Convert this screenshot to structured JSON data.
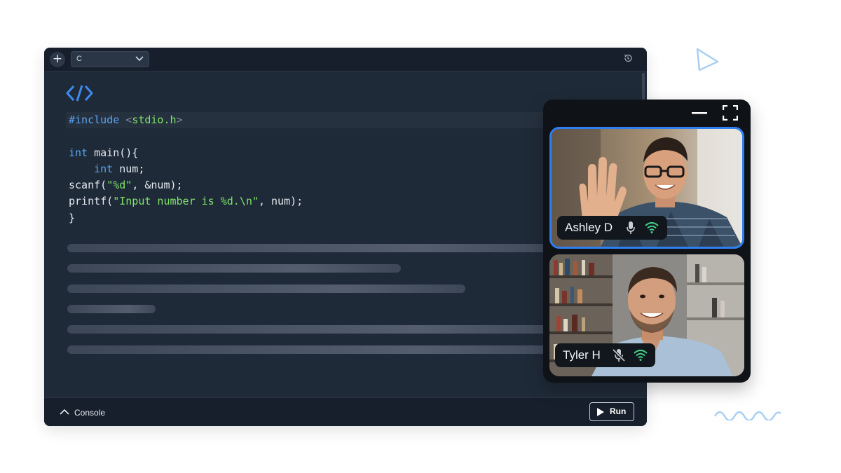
{
  "toolbar": {
    "add_icon": "plus-icon",
    "language_value": "C",
    "history_icon": "history-icon"
  },
  "editor": {
    "header_icon": "code-brackets-icon",
    "colors": {
      "keyword": "#5aa3f0",
      "string": "#7ee36b",
      "text": "#e4e9ef"
    },
    "code": {
      "line1_directive": "#include",
      "line1_lt": "<",
      "line1_header": "stdio.h",
      "line1_gt": ">",
      "line3_kw": "int",
      "line3_rest": " main(){",
      "line4_indent": "    ",
      "line4_kw": "int",
      "line4_rest": " num;",
      "line5_pre": "scanf(",
      "line5_str": "\"%d\"",
      "line5_post": ", &num);",
      "line6_pre": "printf(",
      "line6_str": "\"Input number is %d.\\n\"",
      "line6_post": ", num);",
      "line7": "}"
    }
  },
  "console": {
    "label": "Console",
    "run_label": "Run"
  },
  "video": {
    "accent": "#2f7ff0",
    "participants": [
      {
        "name": "Ashley D",
        "mic": "mic-on",
        "signal": "wifi-strong",
        "speaking": true
      },
      {
        "name": "Tyler H",
        "mic": "mic-muted",
        "signal": "wifi-strong",
        "speaking": false
      }
    ]
  }
}
